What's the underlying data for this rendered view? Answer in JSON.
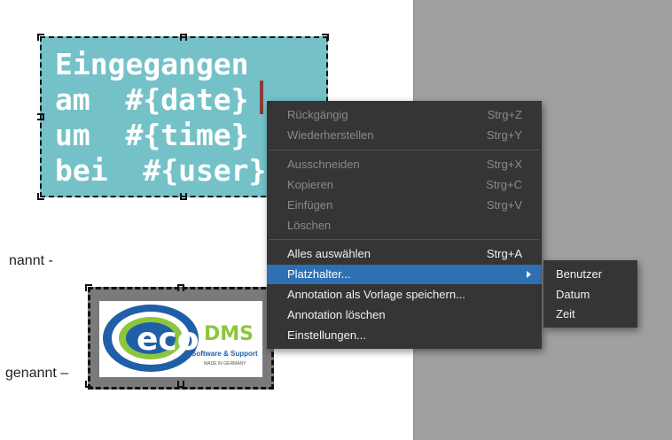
{
  "document": {
    "line1_fragment": "nannt -",
    "line2_fragment": "genannt –"
  },
  "annotation": {
    "lines": [
      "Eingegangen",
      "am  #{date}",
      "um  #{time}",
      "bei  #{user}"
    ],
    "background_color": "#74c2c8"
  },
  "logo": {
    "brand_eco": "eco",
    "brand_dms": "DMS",
    "tagline": "Software & Support",
    "subline": "MADE IN GERMANY"
  },
  "context_menu": {
    "items": [
      {
        "label": "Rückgängig",
        "shortcut": "Strg+Z",
        "enabled": false
      },
      {
        "label": "Wiederherstellen",
        "shortcut": "Strg+Y",
        "enabled": false
      },
      {
        "label": "Ausschneiden",
        "shortcut": "Strg+X",
        "enabled": false
      },
      {
        "label": "Kopieren",
        "shortcut": "Strg+C",
        "enabled": false
      },
      {
        "label": "Einfügen",
        "shortcut": "Strg+V",
        "enabled": false
      },
      {
        "label": "Löschen",
        "shortcut": "",
        "enabled": false
      },
      {
        "label": "Alles auswählen",
        "shortcut": "Strg+A",
        "enabled": true
      },
      {
        "label": "Platzhalter...",
        "shortcut": "",
        "enabled": true,
        "highlighted": true,
        "submenu": true
      },
      {
        "label": "Annotation als Vorlage speichern...",
        "shortcut": "",
        "enabled": true
      },
      {
        "label": "Annotation löschen",
        "shortcut": "",
        "enabled": true
      },
      {
        "label": "Einstellungen...",
        "shortcut": "",
        "enabled": true
      }
    ],
    "highlight_color": "#2f6fb3"
  },
  "submenu": {
    "items": [
      "Benutzer",
      "Datum",
      "Zeit"
    ]
  }
}
